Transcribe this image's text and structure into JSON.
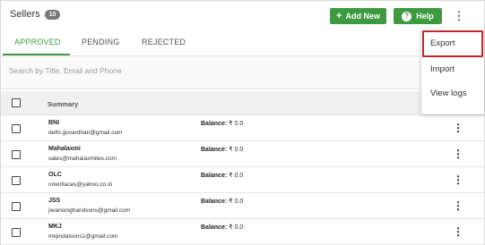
{
  "header": {
    "title": "Sellers",
    "count": "10",
    "add_new_label": "Add New",
    "help_label": "Help",
    "help_glyph": "?",
    "add_glyph": "+",
    "kebab_glyph": "⋮"
  },
  "tabs": [
    {
      "label": "APPROVED",
      "active": true
    },
    {
      "label": "PENDING",
      "active": false
    },
    {
      "label": "REJECTED",
      "active": false
    }
  ],
  "search": {
    "placeholder": "Search by Title, Email and Phone",
    "value": ""
  },
  "table": {
    "summary_header": "Summary",
    "balance_label": "Balance:",
    "rows": [
      {
        "name": "BNI",
        "email": "delhi.govardhan@gmail.com",
        "balance": "₹ 0.0"
      },
      {
        "name": "Mahalaxmi",
        "email": "sales@mahalaxmitex.com",
        "balance": "₹ 0.0"
      },
      {
        "name": "OLC",
        "email": "orientlaces@yahoo.co.in",
        "balance": "₹ 0.0"
      },
      {
        "name": "JSS",
        "email": "jiwansinghandsons@gmail.com",
        "balance": "₹ 0.0"
      },
      {
        "name": "MKJ",
        "email": "mkjindalsons1@gmail.com",
        "balance": "₹ 0.0"
      }
    ]
  },
  "dropdown": {
    "items": [
      "Export",
      "Import",
      "View logs"
    ],
    "highlighted": "Export"
  },
  "colors": {
    "accent_green": "#3e9a40",
    "highlight_red": "#c0282d"
  },
  "icons": {
    "add": "plus-icon",
    "help": "question-circle-icon",
    "more": "kebab-menu-icon"
  }
}
